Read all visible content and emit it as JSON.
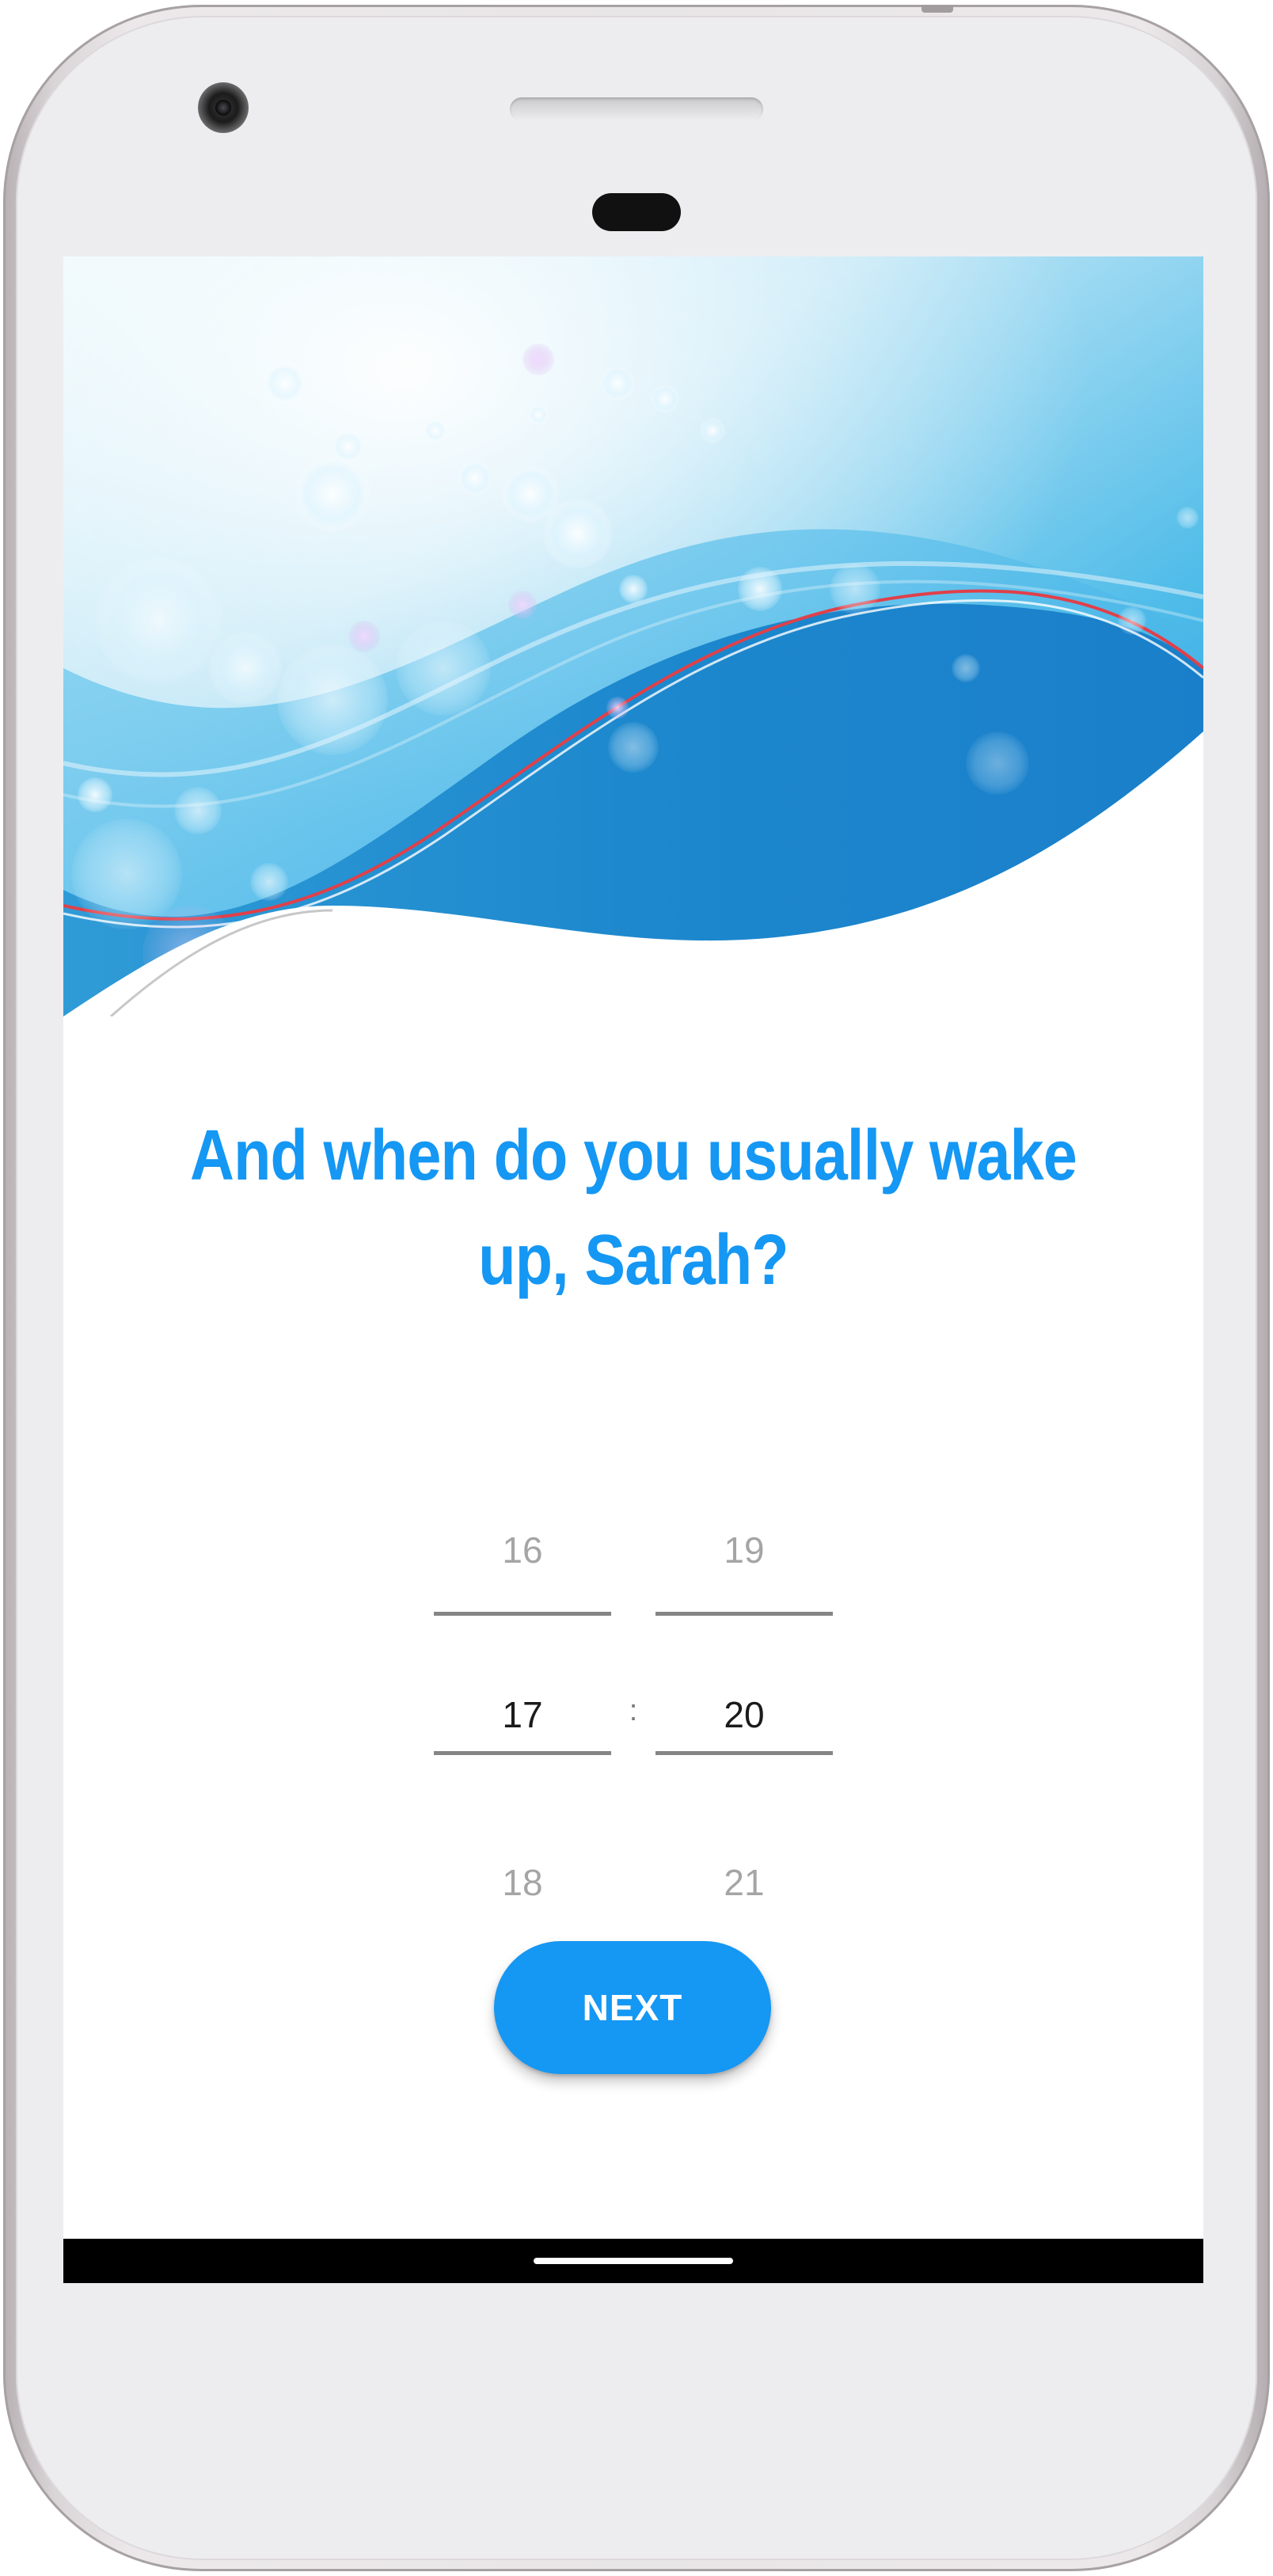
{
  "screen": {
    "question": "And when do you usually wake up, Sarah?"
  },
  "time_picker": {
    "hours": {
      "previous": "16",
      "selected": "17",
      "next": "18"
    },
    "separator": ":",
    "minutes": {
      "previous": "19",
      "selected": "20",
      "next": "21"
    }
  },
  "next_button": {
    "label": "NEXT"
  },
  "colors": {
    "accent": "#1597f4",
    "selected_text": "#1b1b1b",
    "dim_text": "#a5a5a5",
    "divider": "#858585",
    "nav_bar": "#000000"
  },
  "icons": [
    "home-indicator-icon",
    "front-camera-icon"
  ]
}
